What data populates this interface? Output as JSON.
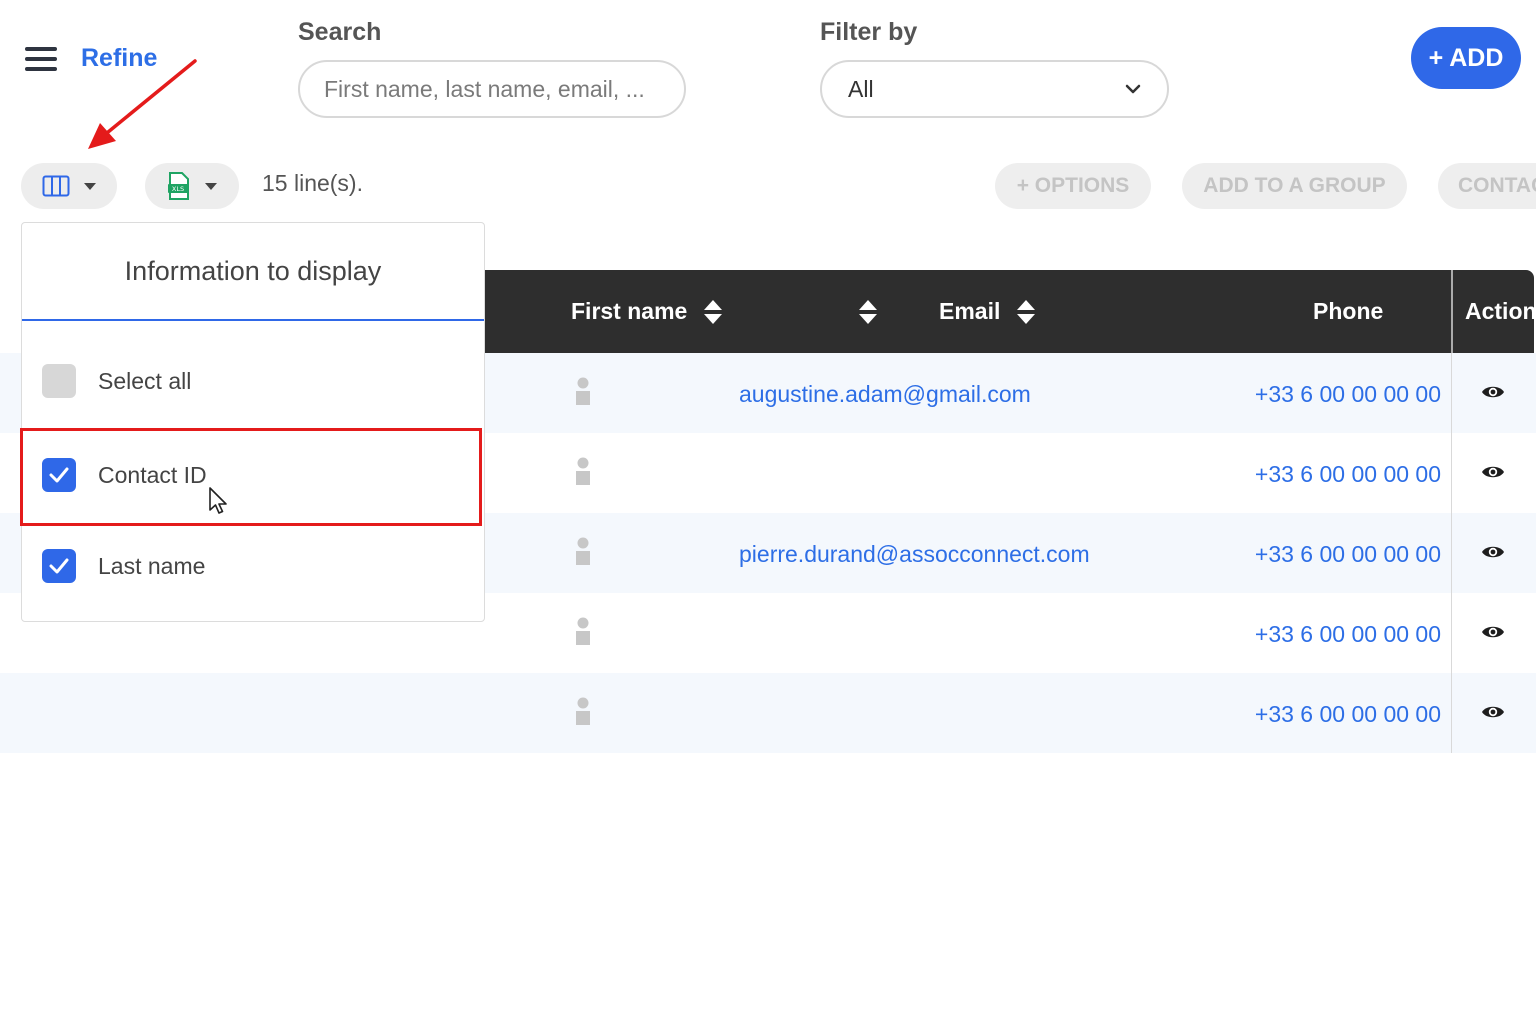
{
  "header": {
    "refine_label": "Refine",
    "search_label": "Search",
    "search_placeholder": "First name, last name, email, ...",
    "filter_label": "Filter by",
    "filter_value": "All",
    "add_label": "+ ADD"
  },
  "toolbar": {
    "lines_count": "15 line(s).",
    "options_label": "+ OPTIONS",
    "add_to_group_label": "ADD TO A GROUP",
    "contact_label": "CONTAC"
  },
  "columns_panel": {
    "title": "Information to display",
    "options": [
      {
        "label": "Select all",
        "checked": false
      },
      {
        "label": "Contact ID",
        "checked": true
      },
      {
        "label": "Last name",
        "checked": true
      }
    ]
  },
  "table": {
    "headers": {
      "first_name": "First name",
      "email": "Email",
      "phone": "Phone",
      "action": "Action"
    },
    "rows": [
      {
        "email": "augustine.adam@gmail.com",
        "phone": "+33 6 00 00 00 00"
      },
      {
        "email": "",
        "phone": "+33 6 00 00 00 00"
      },
      {
        "email": "pierre.durand@assocconnect.com",
        "phone": "+33 6 00 00 00 00"
      },
      {
        "email": "",
        "phone": "+33 6 00 00 00 00"
      },
      {
        "email": "",
        "phone": "+33 6 00 00 00 00"
      }
    ]
  },
  "colors": {
    "accent": "#2f68e8",
    "link": "#2d6ee6",
    "header_bg": "#2e2e2e",
    "highlight": "#e41b1b"
  }
}
